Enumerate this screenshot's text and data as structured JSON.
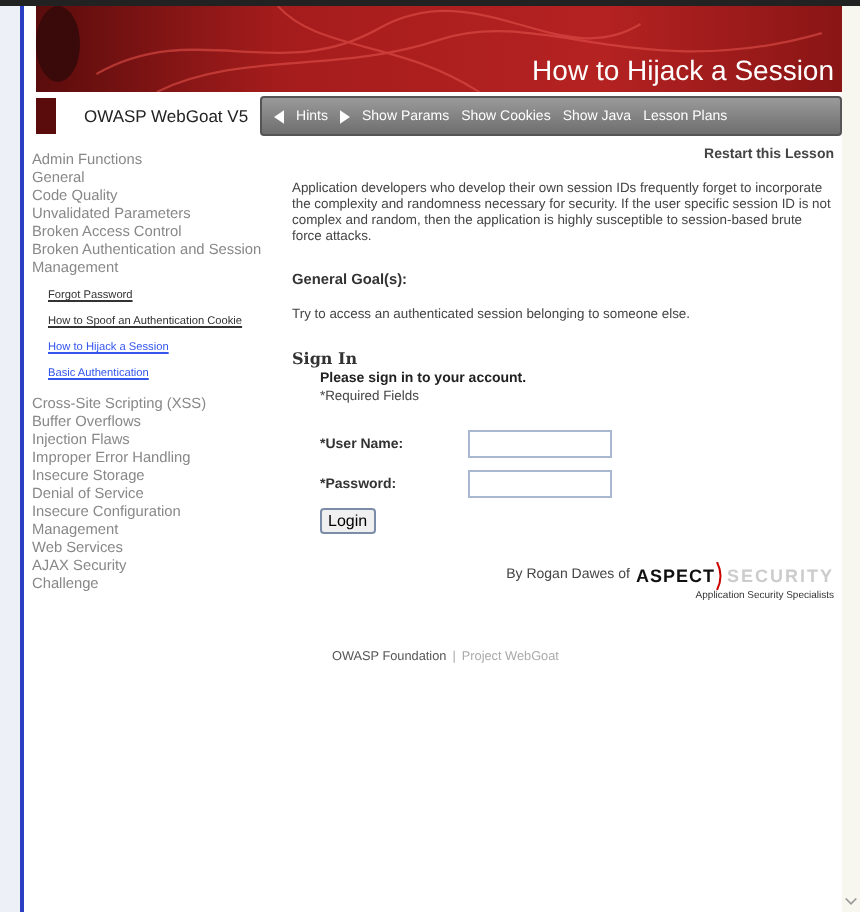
{
  "header": {
    "lesson_title": "How to Hijack a Session",
    "logo": "OWASP  WebGoat V5"
  },
  "nav": {
    "hints": "Hints",
    "items": [
      "Show Params",
      "Show Cookies",
      "Show Java",
      "Lesson Plans"
    ]
  },
  "sidebar": {
    "items": [
      {
        "label": "Admin Functions"
      },
      {
        "label": "General"
      },
      {
        "label": "Code Quality"
      },
      {
        "label": "Unvalidated Parameters"
      },
      {
        "label": "Broken Access Control"
      },
      {
        "label": "Broken Authentication and Session Management",
        "children": [
          {
            "label": "Forgot Password",
            "visited": true
          },
          {
            "label": "How to Spoof an Authentication Cookie",
            "visited": true
          },
          {
            "label": "How to Hijack a Session",
            "visited": false
          },
          {
            "label": "Basic Authentication",
            "visited": false
          }
        ]
      },
      {
        "label": "Cross-Site Scripting (XSS)"
      },
      {
        "label": "Buffer Overflows"
      },
      {
        "label": "Injection Flaws"
      },
      {
        "label": "Improper Error Handling"
      },
      {
        "label": "Insecure Storage"
      },
      {
        "label": "Denial of Service"
      },
      {
        "label": "Insecure Configuration Management"
      },
      {
        "label": "Web Services"
      },
      {
        "label": "AJAX Security"
      },
      {
        "label": "Challenge"
      }
    ]
  },
  "content": {
    "restart": "Restart this Lesson",
    "description": "Application developers who develop their own session IDs frequently forget to incorporate the complexity and randomness necessary for security. If the user specific session ID is not complex and random, then the application is highly susceptible to session-based brute force attacks.",
    "goal_heading": "General Goal(s):",
    "goal": "Try to access an authenticated session belonging to someone else.",
    "form": {
      "heading": "Sign In",
      "prompt": "Please sign in to your account.",
      "required": "*Required Fields",
      "fields": [
        {
          "label": "*User Name:"
        },
        {
          "label": "*Password:"
        }
      ],
      "button": "Login"
    },
    "credit": "By Rogan Dawes of",
    "brand": {
      "left": "ASPECT",
      "right": "SECURITY",
      "tagline": "Application Security Specialists"
    }
  },
  "footer": {
    "left": "OWASP Foundation",
    "separator": "|",
    "right": "Project WebGoat"
  }
}
